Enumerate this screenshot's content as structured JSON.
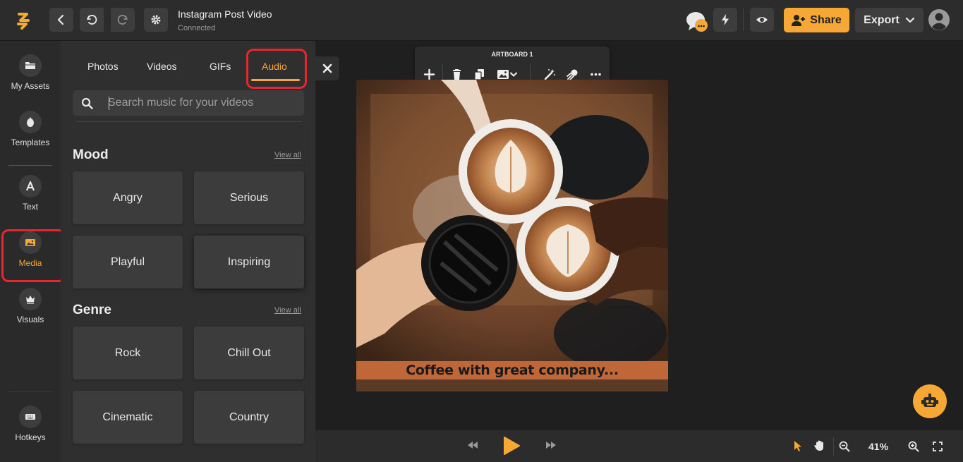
{
  "header": {
    "title": "Instagram Post Video",
    "status": "Connected",
    "share_label": "Share",
    "export_label": "Export"
  },
  "rail": {
    "items": [
      {
        "label": "My Assets"
      },
      {
        "label": "Templates"
      },
      {
        "label": "Text"
      },
      {
        "label": "Media"
      },
      {
        "label": "Visuals"
      },
      {
        "label": "Hotkeys"
      }
    ]
  },
  "panel": {
    "tabs": [
      {
        "label": "Photos"
      },
      {
        "label": "Videos"
      },
      {
        "label": "GIFs"
      },
      {
        "label": "Audio"
      }
    ],
    "search_placeholder": "Search music for your videos",
    "mood": {
      "title": "Mood",
      "view_all": "View all",
      "items": [
        "Angry",
        "Serious",
        "Playful",
        "Inspiring"
      ]
    },
    "genre": {
      "title": "Genre",
      "view_all": "View all",
      "items": [
        "Rock",
        "Chill Out",
        "Cinematic",
        "Country"
      ]
    }
  },
  "artboard": {
    "label": "ARTBOARD 1",
    "caption": "Coffee with great company..."
  },
  "bottombar": {
    "zoom": "41%"
  },
  "colors": {
    "accent": "#f7a733",
    "highlight": "#e8262f"
  }
}
